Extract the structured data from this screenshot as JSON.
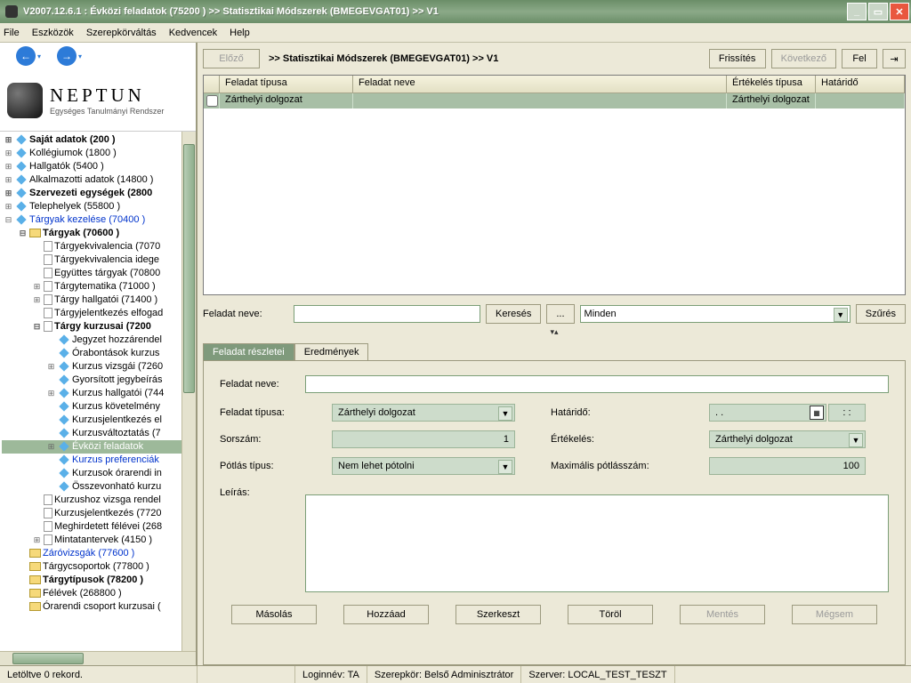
{
  "window": {
    "title": "V2007.12.6.1 : Évközi feladatok (75200  )  >> Statisztikai Módszerek (BMEGEVGAT01) >> V1"
  },
  "menu": {
    "items": [
      "File",
      "Eszközök",
      "Szerepkörváltás",
      "Kedvencek",
      "Help"
    ]
  },
  "logo": {
    "title": "NEPTUN",
    "subtitle": "Egységes Tanulmányi Rendszer"
  },
  "tree": [
    {
      "t": "Saját adatok (200  )",
      "lvl": 0,
      "exp": "+",
      "bold": true,
      "icon": "diamond"
    },
    {
      "t": "Kollégiumok (1800  )",
      "lvl": 0,
      "exp": "+",
      "icon": "diamond"
    },
    {
      "t": "Hallgatók (5400  )",
      "lvl": 0,
      "exp": "+",
      "icon": "diamond"
    },
    {
      "t": "Alkalmazotti adatok (14800  )",
      "lvl": 0,
      "exp": "+",
      "icon": "diamond"
    },
    {
      "t": "Szervezeti egységek (2800",
      "lvl": 0,
      "exp": "+",
      "bold": true,
      "icon": "diamond"
    },
    {
      "t": "Telephelyek (55800  )",
      "lvl": 0,
      "exp": "+",
      "icon": "diamond"
    },
    {
      "t": "Tárgyak kezelése (70400  )",
      "lvl": 0,
      "exp": "-",
      "blue": true,
      "icon": "diamond"
    },
    {
      "t": "Tárgyak (70600  )",
      "lvl": 1,
      "exp": "-",
      "bold": true,
      "icon": "folder"
    },
    {
      "t": "Tárgyekvivalencia (7070",
      "lvl": 2,
      "exp": " ",
      "icon": "page"
    },
    {
      "t": "Tárgyekvivalencia idege",
      "lvl": 2,
      "exp": " ",
      "icon": "page"
    },
    {
      "t": "Együttes tárgyak (70800",
      "lvl": 2,
      "exp": " ",
      "icon": "page"
    },
    {
      "t": "Tárgytematika (71000  )",
      "lvl": 2,
      "exp": "+",
      "icon": "page"
    },
    {
      "t": "Tárgy hallgatói (71400  )",
      "lvl": 2,
      "exp": "+",
      "icon": "page"
    },
    {
      "t": "Tárgyjelentkezés elfogad",
      "lvl": 2,
      "exp": " ",
      "icon": "page"
    },
    {
      "t": "Tárgy kurzusai (7200",
      "lvl": 2,
      "exp": "-",
      "bold": true,
      "icon": "page"
    },
    {
      "t": "Jegyzet hozzárendel",
      "lvl": 3,
      "exp": " ",
      "icon": "diamond"
    },
    {
      "t": "Órabontások kurzus",
      "lvl": 3,
      "exp": " ",
      "icon": "diamond"
    },
    {
      "t": "Kurzus vizsgái (7260",
      "lvl": 3,
      "exp": "+",
      "icon": "diamond"
    },
    {
      "t": "Gyorsított jegybeírás",
      "lvl": 3,
      "exp": " ",
      "icon": "diamond"
    },
    {
      "t": "Kurzus hallgatói (744",
      "lvl": 3,
      "exp": "+",
      "icon": "diamond"
    },
    {
      "t": "Kurzus követelmény",
      "lvl": 3,
      "exp": " ",
      "icon": "diamond"
    },
    {
      "t": "Kurzusjelentkezés el",
      "lvl": 3,
      "exp": " ",
      "icon": "diamond"
    },
    {
      "t": "Kurzusváltoztatás (7",
      "lvl": 3,
      "exp": " ",
      "icon": "diamond"
    },
    {
      "t": "Évközi feladatok",
      "lvl": 3,
      "exp": "+",
      "sel": true,
      "icon": "diamond"
    },
    {
      "t": "Kurzus preferenciák",
      "lvl": 3,
      "exp": " ",
      "blue": true,
      "icon": "diamond"
    },
    {
      "t": "Kurzusok órarendi in",
      "lvl": 3,
      "exp": " ",
      "icon": "diamond"
    },
    {
      "t": "Összevonható kurzu",
      "lvl": 3,
      "exp": " ",
      "icon": "diamond"
    },
    {
      "t": "Kurzushoz vizsga rendel",
      "lvl": 2,
      "exp": " ",
      "icon": "page"
    },
    {
      "t": "Kurzusjelentkezés (7720",
      "lvl": 2,
      "exp": " ",
      "icon": "page"
    },
    {
      "t": "Meghirdetett félévei (268",
      "lvl": 2,
      "exp": " ",
      "icon": "page"
    },
    {
      "t": "Mintatantervek (4150  )",
      "lvl": 2,
      "exp": "+",
      "icon": "page"
    },
    {
      "t": "Záróvizsgák (77600  )",
      "lvl": 1,
      "exp": " ",
      "blue": true,
      "icon": "folder"
    },
    {
      "t": "Tárgycsoportok (77800  )",
      "lvl": 1,
      "exp": " ",
      "icon": "folder"
    },
    {
      "t": "Tárgytípusok (78200  )",
      "lvl": 1,
      "exp": " ",
      "bold": true,
      "icon": "folder"
    },
    {
      "t": "Félévek (268800  )",
      "lvl": 1,
      "exp": " ",
      "icon": "folder"
    },
    {
      "t": "Órarendi csoport kurzusai (",
      "lvl": 1,
      "exp": " ",
      "icon": "folder"
    }
  ],
  "toolbar": {
    "prev": "Előző",
    "breadcrumb": ">> Statisztikai Módszerek (BMEGEVGAT01) >> V1",
    "refresh": "Frissítés",
    "next": "Következő",
    "up": "Fel"
  },
  "grid": {
    "headers": {
      "type": "Feladat típusa",
      "name": "Feladat neve",
      "eval": "Értékelés típusa",
      "due": "Határidő"
    },
    "rows": [
      {
        "type": "Zárthelyi dolgozat",
        "name": "",
        "eval": "Zárthelyi dolgozat",
        "due": ""
      }
    ]
  },
  "search": {
    "label": "Feladat neve:",
    "keres": "Keresés",
    "filter_value": "Minden",
    "szures": "Szűrés"
  },
  "tabs": {
    "details": "Feladat részletei",
    "results": "Eredmények"
  },
  "form": {
    "l_name": "Feladat neve:",
    "l_type": "Feladat típusa:",
    "v_type": "Zárthelyi dolgozat",
    "l_due": "Határidő:",
    "v_due_date": ". .",
    "v_due_time": ": :",
    "l_sorszam": "Sorszám:",
    "v_sorszam": "1",
    "l_ertekeles": "Értékelés:",
    "v_ertekeles": "Zárthelyi dolgozat",
    "l_potlas": "Pótlás típus:",
    "v_potlas": "Nem lehet pótolni",
    "l_max": "Maximális pótlásszám:",
    "v_max": "100",
    "l_leiras": "Leírás:"
  },
  "actions": {
    "copy": "Másolás",
    "add": "Hozzáad",
    "edit": "Szerkeszt",
    "del": "Töröl",
    "save": "Mentés",
    "cancel": "Mégsem"
  },
  "status": {
    "left": "Letöltve 0 rekord.",
    "login": "Loginnév: TA",
    "role": "Szerepkör: Belső Adminisztrátor",
    "server": "Szerver: LOCAL_TEST_TESZT"
  }
}
